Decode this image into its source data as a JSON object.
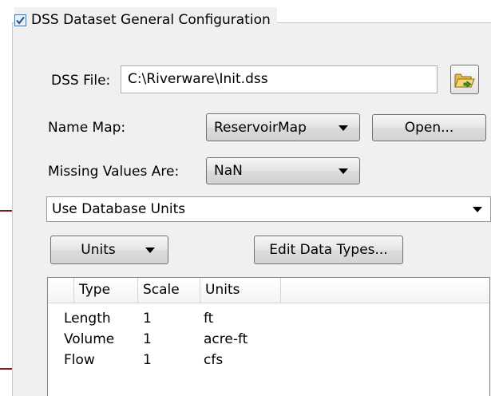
{
  "group": {
    "title": "DSS Dataset General Configuration",
    "enabled": true
  },
  "dss_file": {
    "label": "DSS File:",
    "value": "C:\\Riverware\\Init.dss",
    "browse_icon": "folder-open-icon"
  },
  "name_map": {
    "label": "Name Map:",
    "selected": "ReservoirMap",
    "open_label": "Open..."
  },
  "missing_values": {
    "label": "Missing Values Are:",
    "selected": "NaN"
  },
  "units_mode": {
    "selected": "Use Database Units"
  },
  "toolbar": {
    "units_label": "Units",
    "edit_data_types_label": "Edit Data Types..."
  },
  "units_table": {
    "columns": [
      "Type",
      "Scale",
      "Units"
    ],
    "rows": [
      {
        "type": "Length",
        "scale": "1",
        "units": "ft"
      },
      {
        "type": "Volume",
        "scale": "1",
        "units": "acre-ft"
      },
      {
        "type": "Flow",
        "scale": "1",
        "units": "cfs"
      }
    ]
  },
  "colors": {
    "panel_bg": "#f0f0f0",
    "checkbox_border": "#4a76a8",
    "check_mark": "#1a4f8a",
    "margin_line": "#7f1d1d"
  }
}
